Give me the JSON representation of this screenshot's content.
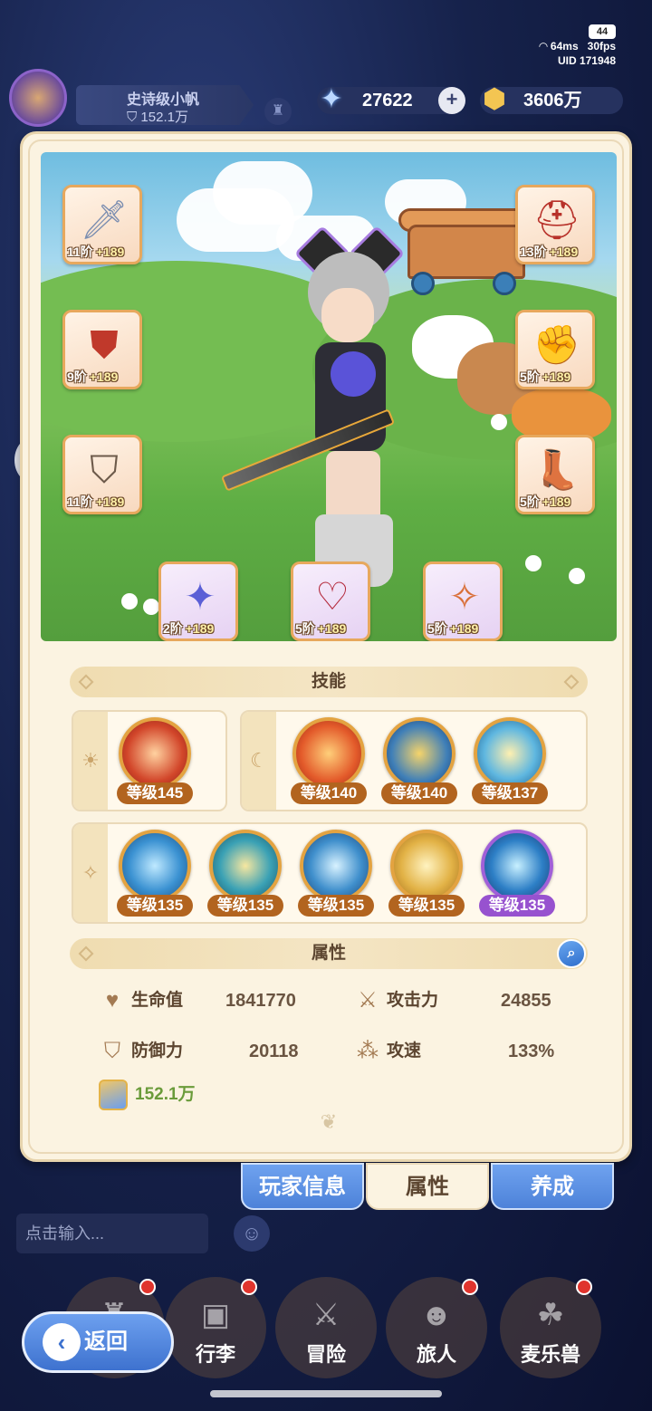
{
  "status": {
    "battery": "44",
    "ping": "64ms",
    "fps": "30fps",
    "uid_label": "UID",
    "uid": "171948"
  },
  "profile": {
    "name": "史诗级小帆",
    "power": "152.1万"
  },
  "resources": {
    "gems": "27622",
    "gold": "3606万"
  },
  "equipment": [
    {
      "icon": "sword-icon",
      "tier": "11阶",
      "bonus": "+189"
    },
    {
      "icon": "helmet-icon",
      "tier": "13阶",
      "bonus": "+189"
    },
    {
      "icon": "chest-armor-icon",
      "tier": "9阶",
      "bonus": "+189"
    },
    {
      "icon": "gauntlet-icon",
      "tier": "5阶",
      "bonus": "+189"
    },
    {
      "icon": "leg-armor-icon",
      "tier": "11阶",
      "bonus": "+189"
    },
    {
      "icon": "boots-icon",
      "tier": "5阶",
      "bonus": "+189"
    },
    {
      "icon": "ring-icon",
      "tier": "2阶",
      "bonus": "+189"
    },
    {
      "icon": "necklace-icon",
      "tier": "5阶",
      "bonus": "+189"
    },
    {
      "icon": "talisman-icon",
      "tier": "5阶",
      "bonus": "+189"
    }
  ],
  "skills_title": "技能",
  "skills": {
    "sun": [
      {
        "level": "等级145"
      }
    ],
    "moon": [
      {
        "level": "等级140"
      },
      {
        "level": "等级140"
      },
      {
        "level": "等级137"
      }
    ],
    "star": [
      {
        "level": "等级135"
      },
      {
        "level": "等级135"
      },
      {
        "level": "等级135"
      },
      {
        "level": "等级135"
      },
      {
        "level": "等级135"
      }
    ]
  },
  "attributes_title": "属性",
  "attributes": {
    "hp_label": "生命值",
    "hp": "1841770",
    "atk_label": "攻击力",
    "atk": "24855",
    "def_label": "防御力",
    "def": "20118",
    "spd_label": "攻速",
    "spd": "133%",
    "power": "152.1万"
  },
  "tabs": {
    "player_info": "玩家信息",
    "attributes": "属性",
    "develop": "养成"
  },
  "chat": {
    "placeholder": "点击输入..."
  },
  "nav": {
    "bag": "行李",
    "adventure": "冒险",
    "traveler": "旅人",
    "pet": "麦乐兽"
  },
  "back": "返回",
  "colors": {
    "card_bg": "#fbf3e1",
    "accent_blue": "#4d82d9",
    "level_badge": "#b2641f",
    "level_badge_purple": "#9752cf"
  }
}
